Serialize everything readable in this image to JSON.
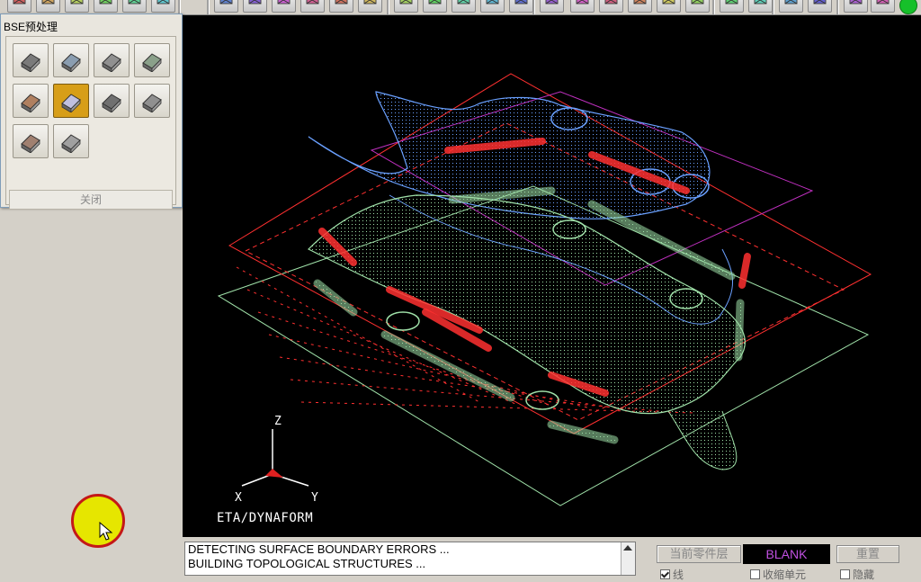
{
  "toolbar": {
    "icons": [
      "new-icon",
      "open-icon",
      "save-icon",
      "print-icon",
      "layers-icon",
      "cut-icon",
      "view-front-icon",
      "view-back-icon",
      "view-left-icon",
      "view-right-icon",
      "view-top-icon",
      "view-bottom-icon",
      "rotate-icon",
      "pan-icon",
      "zoom-icon",
      "zoom-box-icon",
      "fit-icon",
      "grid-icon",
      "view-iso-icon",
      "shade-icon",
      "wireframe-icon",
      "hidden-line-icon",
      "mesh-icon",
      "surface-icon",
      "trim-icon",
      "pencil-icon",
      "eyedropper-icon",
      "list-icon",
      "menu-icon"
    ],
    "status_color": "#16c02a"
  },
  "dialog": {
    "title": "BSE预处理",
    "tools": [
      "copy-part-icon",
      "surface-mesh-icon",
      "blank-icon",
      "layer-sheet-icon",
      "flange-unfold-icon",
      "surface-patch-icon",
      "symmetry-icon",
      "grid-mesh-icon",
      "die-addendum-icon",
      "part-calc-icon"
    ],
    "active_tool_index": 5,
    "close_label": "关闭"
  },
  "viewport": {
    "brand": "ETA/DYNAFORM",
    "axes": {
      "z": "Z",
      "x": "X",
      "y": "Y"
    },
    "colors": {
      "background": "#000000",
      "upper_die": "#6aa0ff",
      "lower_part": "#9fe0a8",
      "binder": "#ff3030",
      "blank_outline": "#c030c0"
    }
  },
  "console": {
    "lines": [
      "DETECTING SURFACE BOUNDARY ERRORS ...",
      "BUILDING TOPOLOGICAL STRUCTURES ..."
    ]
  },
  "layer_panel": {
    "current_layer_label": "当前零件层",
    "current_layer_value": "BLANK",
    "reset_label": "重置",
    "checkboxes": [
      {
        "label": "线",
        "checked": true
      },
      {
        "label": "收缩单元",
        "checked": false
      },
      {
        "label": "隐藏",
        "checked": false
      }
    ]
  }
}
